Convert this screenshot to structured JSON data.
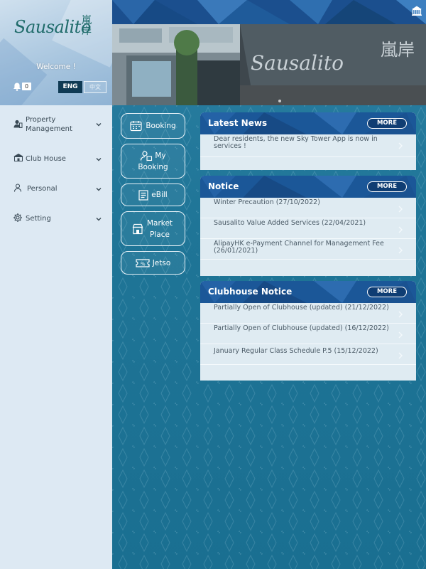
{
  "sidebar": {
    "logo_text": "Sausalito",
    "logo_cjk": "嵐岸",
    "welcome": "Welcome !",
    "notification_count": "0",
    "lang_eng": "ENG",
    "lang_zh": "中文",
    "menu": [
      {
        "label": "Property Management",
        "icon": "building-user-icon"
      },
      {
        "label": "Club House",
        "icon": "clubhouse-icon"
      },
      {
        "label": "Personal",
        "icon": "person-icon"
      },
      {
        "label": "Setting",
        "icon": "gear-icon"
      }
    ]
  },
  "shortcuts": [
    {
      "label": "Booking",
      "icon": "calendar-icon"
    },
    {
      "label": "My Booking",
      "icon": "person-calendar-icon"
    },
    {
      "label": "eBill",
      "icon": "bill-icon"
    },
    {
      "label": "Market Place",
      "icon": "shop-icon"
    },
    {
      "label": "Jetso",
      "icon": "coupon-icon"
    }
  ],
  "banner": {
    "sign_script": "Sausalito",
    "sign_cjk": "嵐岸"
  },
  "panels": {
    "latest_news": {
      "title": "Latest News",
      "more": "MORE",
      "items": [
        "Dear residents, the new Sky Tower App is now in services !"
      ]
    },
    "notice": {
      "title": "Notice",
      "more": "MORE",
      "items": [
        "Winter Precaution (27/10/2022)",
        "Sausalito Value Added Services (22/04/2021)",
        "AlipayHK e-Payment Channel for Management Fee (26/01/2021)"
      ]
    },
    "clubhouse_notice": {
      "title": "Clubhouse Notice",
      "more": "MORE",
      "items": [
        "Partially Open of Clubhouse (updated) (21/12/2022)",
        "Partially Open of Clubhouse (updated) (16/12/2022)",
        "January Regular Class Schedule P.5 (15/12/2022)"
      ]
    }
  },
  "colors": {
    "sidebar_bg": "#dde9f3",
    "main_bg": "#1f7597",
    "panel_header": "#1b5798",
    "panel_body": "#dfebf2",
    "lang_active": "#0f3a54"
  }
}
